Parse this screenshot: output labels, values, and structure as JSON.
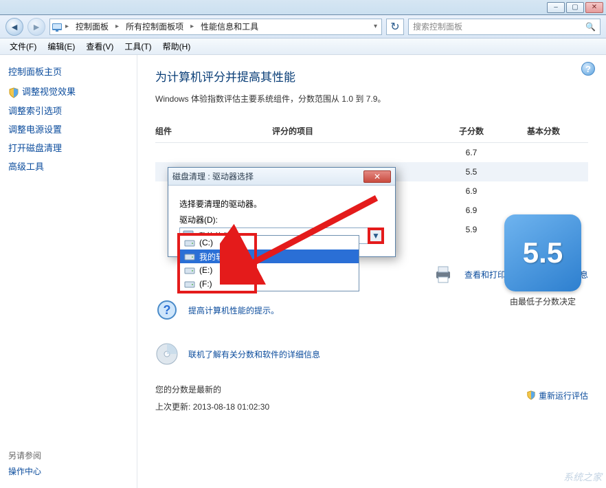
{
  "window_controls": {
    "min": "–",
    "max": "▢",
    "close": "✕"
  },
  "breadcrumb": {
    "icon": "control-panel-icon",
    "segments": [
      "控制面板",
      "所有控制面板项",
      "性能信息和工具"
    ]
  },
  "search": {
    "placeholder": "搜索控制面板"
  },
  "menubar": [
    {
      "label": "文件(F)"
    },
    {
      "label": "编辑(E)"
    },
    {
      "label": "查看(V)"
    },
    {
      "label": "工具(T)"
    },
    {
      "label": "帮助(H)"
    }
  ],
  "sidebar": {
    "home": "控制面板主页",
    "links": [
      "调整视觉效果",
      "调整索引选项",
      "调整电源设置",
      "打开磁盘清理",
      "高级工具"
    ],
    "see_also_hdr": "另请参阅",
    "see_also_link": "操作中心"
  },
  "content": {
    "title": "为计算机评分并提高其性能",
    "desc": "Windows 体验指数评估主要系统组件，分数范围从 1.0 到 7.9。",
    "headers": {
      "c1": "组件",
      "c2": "评分的项目",
      "c3": "子分数",
      "c4": "基本分数"
    },
    "rows": [
      {
        "sub": "6.7"
      },
      {
        "sub": "5.5",
        "hl": true
      },
      {
        "sub": "6.9"
      },
      {
        "sub": "6.9"
      },
      {
        "sub": "5.9"
      }
    ],
    "big_score": "5.5",
    "big_score_lbl": "由最低子分数决定",
    "link_print": "查看和打印详细的性能和系统信息",
    "link_tips": "提高计算机性能的提示。",
    "link_online": "联机了解有关分数和软件的详细信息",
    "footer_latest": "您的分数是最新的",
    "footer_updated_lbl": "上次更新:",
    "footer_updated_val": "2013-08-18 01:02:30",
    "rerun": "重新运行评估"
  },
  "dialog": {
    "title": "磁盘清理 : 驱动器选择",
    "prompt": "选择要清理的驱动器。",
    "drive_label": "驱动器(D):",
    "selected": "我的软件 (D:)",
    "options": [
      {
        "label": "(C:)"
      },
      {
        "label": "我的软件 (D:)",
        "sel": true
      },
      {
        "label": "(E:)"
      },
      {
        "label": "(F:)"
      }
    ]
  },
  "watermark": "系统之家"
}
